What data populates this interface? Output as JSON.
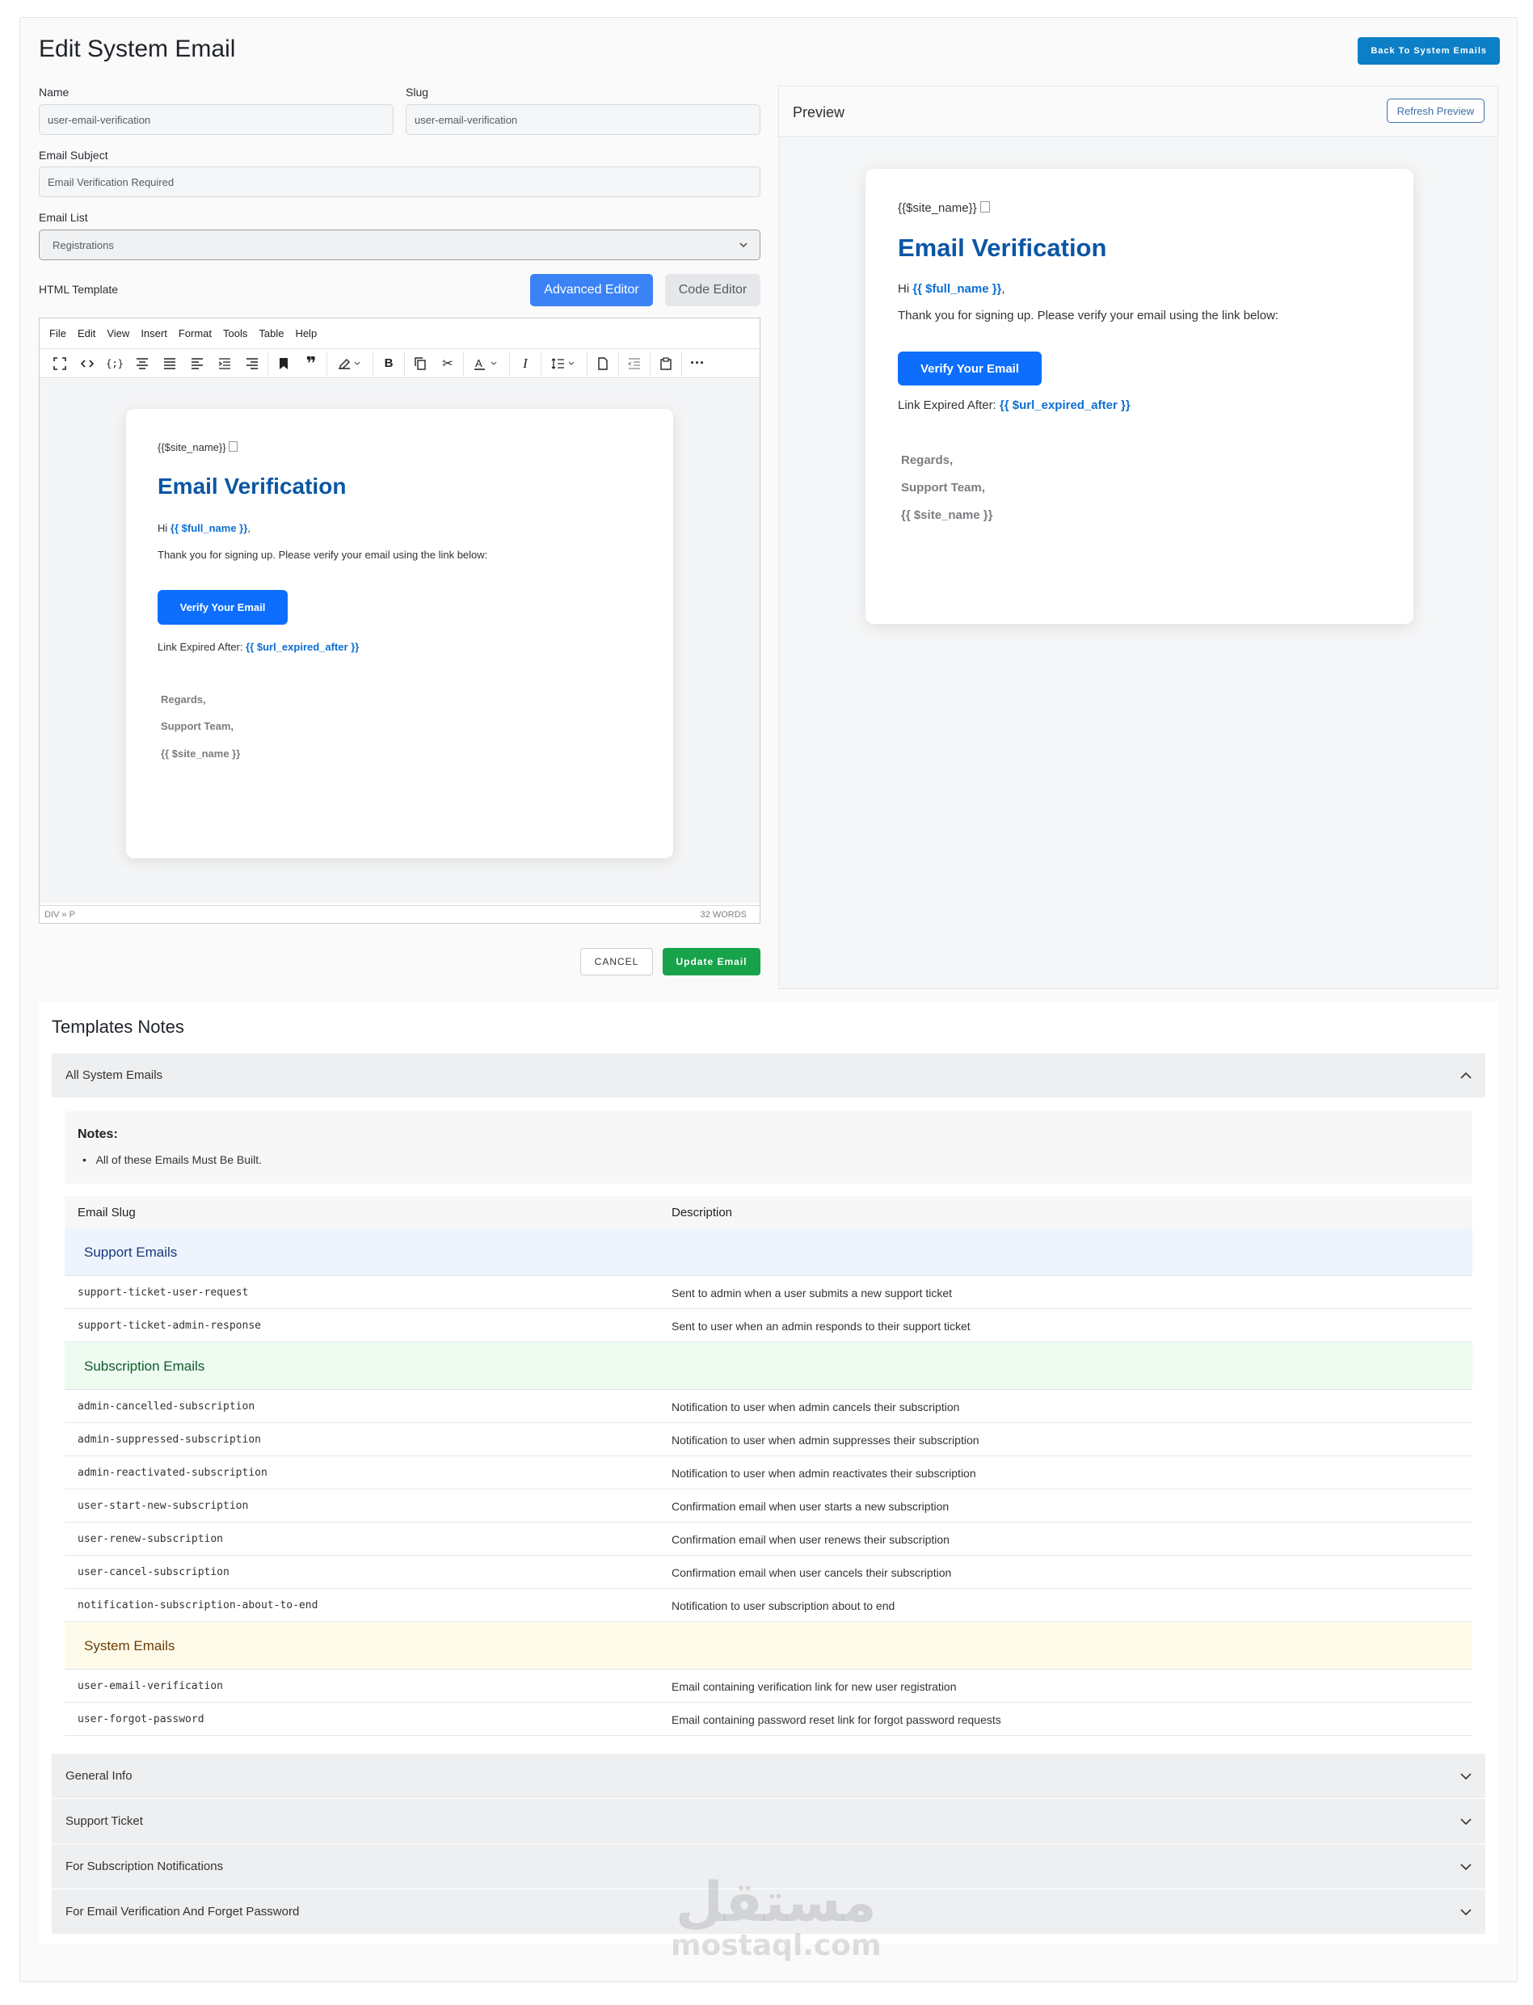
{
  "page": {
    "title": "Edit System Email",
    "back_button": "Back To System Emails"
  },
  "form": {
    "name_label": "Name",
    "name_value": "user-email-verification",
    "slug_label": "Slug",
    "slug_value": "user-email-verification",
    "subject_label": "Email Subject",
    "subject_value": "Email Verification Required",
    "list_label": "Email List",
    "list_value": "Registrations",
    "template_label": "HTML Template",
    "advanced_editor": "Advanced Editor",
    "code_editor": "Code Editor",
    "cancel": "CANCEL",
    "update": "Update Email"
  },
  "editor": {
    "menu": [
      "File",
      "Edit",
      "View",
      "Insert",
      "Format",
      "Tools",
      "Table",
      "Help"
    ],
    "toolbar_icons": [
      "fullscreen-icon",
      "source-code-icon",
      "code-sample-icon",
      "align-center-icon",
      "justify-icon",
      "align-left-icon",
      "indent-list-icon",
      "align-right-icon",
      "bookmark-icon",
      "blockquote-icon",
      "highlight-color-icon",
      "bold-icon",
      "copy-icon",
      "cut-icon",
      "text-color-icon",
      "italic-icon",
      "line-height-icon",
      "new-document-icon",
      "outdent-icon",
      "paste-icon",
      "more-icon"
    ],
    "status_path": "DIV » P",
    "word_count": "32 WORDS"
  },
  "email": {
    "site_name": "{{$site_name}}",
    "heading": "Email Verification",
    "greeting": "Hi",
    "full_name_var": "{{ $full_name }}",
    "greeting_end": ",",
    "body": "Thank you for signing up. Please verify your email using the link below:",
    "button": "Verify Your Email",
    "expiry_label": "Link Expired After:",
    "expiry_var": "{{ $url_expired_after }}",
    "sign_1": "Regards,",
    "sign_2": "Support Team,",
    "sign_3": "{{ $site_name }}"
  },
  "preview": {
    "title": "Preview",
    "refresh": "Refresh Preview"
  },
  "notes": {
    "title": "Templates Notes",
    "open_section": "All System Emails",
    "notes_heading": "Notes:",
    "notes_items": [
      "All of these Emails Must Be Built."
    ],
    "col_slug": "Email Slug",
    "col_desc": "Description",
    "groups": [
      {
        "name": "Support Emails",
        "rows": [
          {
            "slug": "support-ticket-user-request",
            "desc": "Sent to admin when a user submits a new support ticket"
          },
          {
            "slug": "support-ticket-admin-response",
            "desc": "Sent to user when an admin responds to their support ticket"
          }
        ]
      },
      {
        "name": "Subscription Emails",
        "rows": [
          {
            "slug": "admin-cancelled-subscription",
            "desc": "Notification to user when admin cancels their subscription"
          },
          {
            "slug": "admin-suppressed-subscription",
            "desc": "Notification to user when admin suppresses their subscription"
          },
          {
            "slug": "admin-reactivated-subscription",
            "desc": "Notification to user when admin reactivates their subscription"
          },
          {
            "slug": "user-start-new-subscription",
            "desc": "Confirmation email when user starts a new subscription"
          },
          {
            "slug": "user-renew-subscription",
            "desc": "Confirmation email when user renews their subscription"
          },
          {
            "slug": "user-cancel-subscription",
            "desc": "Confirmation email when user cancels their subscription"
          },
          {
            "slug": "notification-subscription-about-to-end",
            "desc": "Notification to user subscription about to end"
          }
        ]
      },
      {
        "name": "System Emails",
        "rows": [
          {
            "slug": "user-email-verification",
            "desc": "Email containing verification link for new user registration"
          },
          {
            "slug": "user-forgot-password",
            "desc": "Email containing password reset link for forgot password requests"
          }
        ]
      }
    ],
    "collapsed_sections": [
      "General Info",
      "Support Ticket",
      "For Subscription Notifications",
      "For Email Verification And Forget Password"
    ]
  },
  "watermark": {
    "arabic": "مستقل",
    "latin": "mostaql.com"
  },
  "colors": {
    "primary": "#3b82f6",
    "back_button": "#0d7fc6",
    "update_button": "#17a34a",
    "heading_blue": "#0b56a4",
    "support_group_bg": "#edf4fe",
    "subscription_group_bg": "#edfbf1",
    "system_group_bg": "#fffbea"
  }
}
